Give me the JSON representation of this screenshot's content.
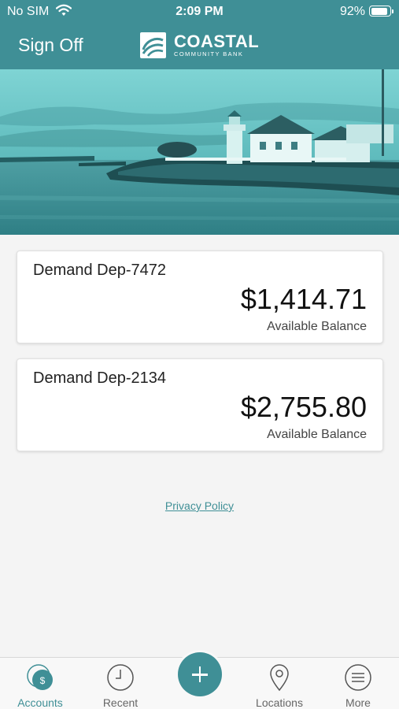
{
  "status_bar": {
    "carrier": "No SIM",
    "time": "2:09 PM",
    "battery_percent": "92%",
    "battery_level": 0.92,
    "wifi_icon": "wifi-icon"
  },
  "header": {
    "sign_off_label": "Sign Off",
    "logo_name": "COASTAL",
    "logo_subtitle": "COMMUNITY BANK"
  },
  "accounts": [
    {
      "name": "Demand Dep-7472",
      "balance": "$1,414.71",
      "balance_label": "Available Balance"
    },
    {
      "name": "Demand Dep-2134",
      "balance": "$2,755.80",
      "balance_label": "Available Balance"
    }
  ],
  "footer": {
    "privacy_link": "Privacy Policy"
  },
  "tabs": [
    {
      "label": "Accounts",
      "icon": "accounts-icon",
      "active": true
    },
    {
      "label": "Recent",
      "icon": "clock-icon",
      "active": false
    },
    {
      "label": "",
      "icon": "plus-icon",
      "active": false
    },
    {
      "label": "Locations",
      "icon": "location-pin-icon",
      "active": false
    },
    {
      "label": "More",
      "icon": "menu-icon",
      "active": false
    }
  ],
  "colors": {
    "brand": "#3f8f96",
    "background": "#f4f4f4",
    "card": "#ffffff"
  }
}
